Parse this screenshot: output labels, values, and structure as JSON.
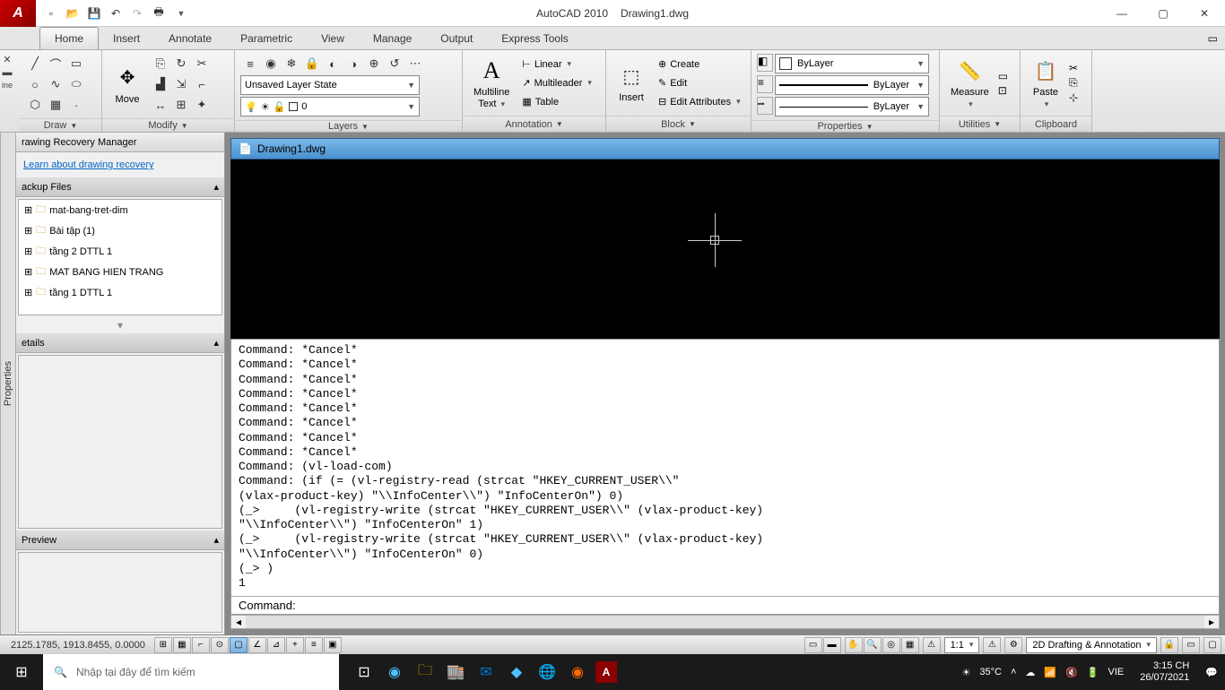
{
  "app": {
    "name": "AutoCAD 2010",
    "doc": "Drawing1.dwg"
  },
  "tabs": [
    "Home",
    "Insert",
    "Annotate",
    "Parametric",
    "View",
    "Manage",
    "Output",
    "Express Tools"
  ],
  "active_tab": 0,
  "panels": {
    "draw": "Draw",
    "modify": "Modify",
    "layers": "Layers",
    "annotation": "Annotation",
    "block": "Block",
    "properties": "Properties",
    "utilities": "Utilities",
    "clipboard": "Clipboard"
  },
  "modify_btn": "Move",
  "layer_state": "Unsaved Layer State",
  "layer_current": "0",
  "anno": {
    "mtext1": "Multiline",
    "mtext2": "Text",
    "linear": "Linear",
    "mleader": "Multileader",
    "table": "Table"
  },
  "block": {
    "insert": "Insert",
    "create": "Create",
    "edit": "Edit",
    "editattr": "Edit Attributes"
  },
  "props": {
    "bylayer": "ByLayer"
  },
  "util": {
    "measure": "Measure"
  },
  "clip": {
    "paste": "Paste"
  },
  "recovery": {
    "title": "rawing Recovery Manager",
    "link": "Learn about drawing recovery",
    "backup": "ackup Files",
    "details": "etails",
    "preview": "Preview",
    "files": [
      "mat-bang-tret-dim",
      "Bài tập (1)",
      "tầng 2  DTTL 1",
      "MAT BANG HIEN TRANG",
      "tầng 1 DTTL 1"
    ]
  },
  "properties_tab": "Properties",
  "doc_tab": "Drawing1.dwg",
  "cmd_history": "Command: *Cancel*\nCommand: *Cancel*\nCommand: *Cancel*\nCommand: *Cancel*\nCommand: *Cancel*\nCommand: *Cancel*\nCommand: *Cancel*\nCommand: *Cancel*\nCommand: (vl-load-com)\nCommand: (if (= (vl-registry-read (strcat \"HKEY_CURRENT_USER\\\\\"\n(vlax-product-key) \"\\\\InfoCenter\\\\\") \"InfoCenterOn\") 0)\n(_>     (vl-registry-write (strcat \"HKEY_CURRENT_USER\\\\\" (vlax-product-key)\n\"\\\\InfoCenter\\\\\") \"InfoCenterOn\" 1)\n(_>     (vl-registry-write (strcat \"HKEY_CURRENT_USER\\\\\" (vlax-product-key)\n\"\\\\InfoCenter\\\\\") \"InfoCenterOn\" 0)\n(_> )\n1",
  "cmd_prompt": "Command:",
  "status": {
    "coords": "2125.1785, 1913.8455, 0.0000",
    "scale": "1:1",
    "workspace": "2D Drafting & Annotation"
  },
  "taskbar": {
    "search_placeholder": "Nhập tại đây để tìm kiếm",
    "temp": "35°C",
    "lang": "VIE",
    "time": "3:15 CH",
    "date": "26/07/2021"
  }
}
